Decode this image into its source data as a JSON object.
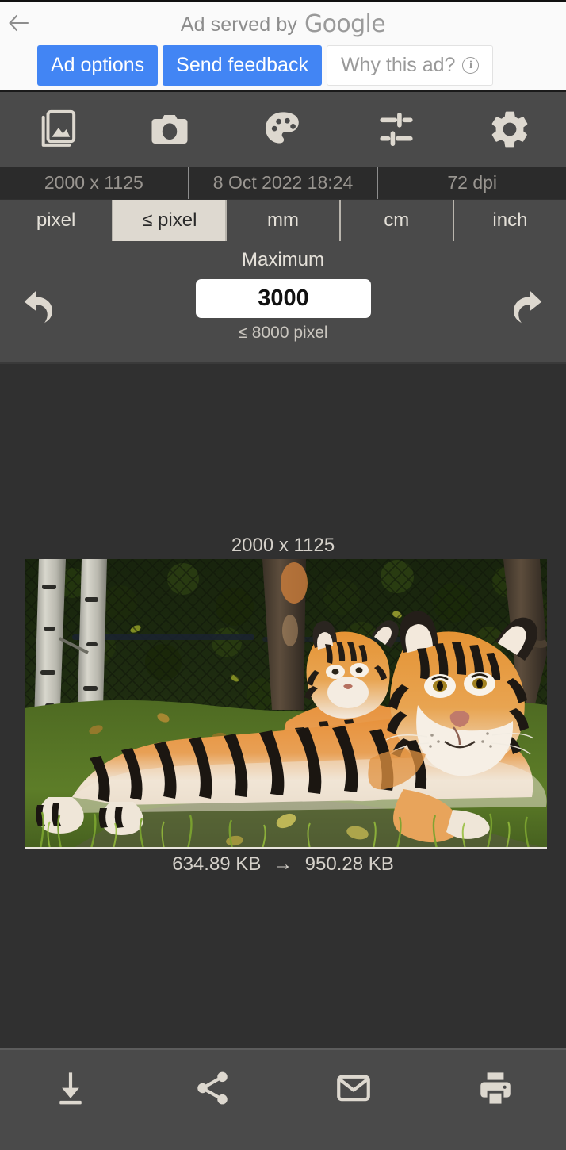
{
  "ad_banner": {
    "back_icon": "back-arrow-icon",
    "served_by_text": "Ad served by",
    "brand": "Google",
    "ad_options_label": "Ad options",
    "send_feedback_label": "Send feedback",
    "why_this_ad_label": "Why this ad?",
    "info_icon": "info-icon",
    "button_color": "#4285f4"
  },
  "toolbar": {
    "items": [
      {
        "name": "gallery-icon",
        "label": "Gallery"
      },
      {
        "name": "camera-icon",
        "label": "Camera"
      },
      {
        "name": "palette-icon",
        "label": "Palette"
      },
      {
        "name": "tune-icon",
        "label": "Tune"
      },
      {
        "name": "settings-gear-icon",
        "label": "Settings"
      }
    ]
  },
  "info": {
    "dimensions": "2000 x 1125",
    "date": "8 Oct 2022 18:24",
    "dpi": "72 dpi"
  },
  "unit_tabs": {
    "selected": "≤ pixel",
    "items": [
      {
        "label": "pixel",
        "selected": false
      },
      {
        "label": "≤ pixel",
        "selected": true
      },
      {
        "label": "mm",
        "selected": false
      },
      {
        "label": "cm",
        "selected": false
      },
      {
        "label": "inch",
        "selected": false
      }
    ]
  },
  "control": {
    "label": "Maximum",
    "value": "3000",
    "placeholder": "3000",
    "hint": "≤ 8000 pixel",
    "undo_icon": "undo-arrow-icon",
    "redo_icon": "redo-arrow-icon"
  },
  "preview": {
    "dimensions": "2000 x 1125",
    "size_before": "634.89 KB",
    "size_arrow": "→",
    "size_after": "950.28 KB",
    "image_alt": "Two tigers resting on grass near birch trees"
  },
  "bottom_bar": {
    "items": [
      {
        "name": "download-icon",
        "label": "Download"
      },
      {
        "name": "share-icon",
        "label": "Share"
      },
      {
        "name": "email-icon",
        "label": "Email"
      },
      {
        "name": "print-icon",
        "label": "Print"
      }
    ]
  },
  "colors": {
    "app_background": "#303030",
    "toolbar_background": "#4a4a4a",
    "info_background": "#2b2b2b",
    "selected_tab": "#ded9d0",
    "icon_color": "#ddd8cf",
    "accent_blue": "#4285f4"
  }
}
